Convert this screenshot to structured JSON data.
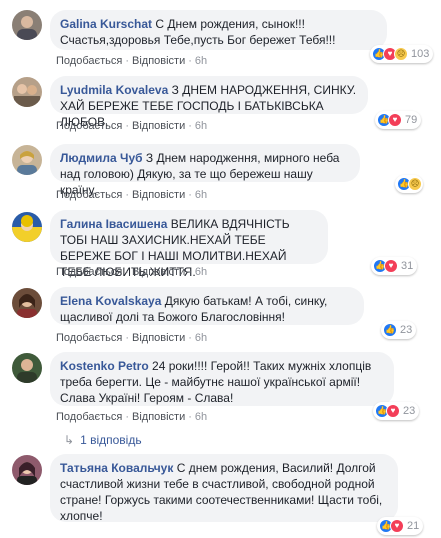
{
  "actions": {
    "like": "Подобається",
    "reply": "Відповісти"
  },
  "comments": [
    {
      "author": "Galina Kurschat",
      "text": "С Днем рождения, сынок!!! Счастья,здоровья Тебе,пусть Бог бережет Тебя!!!",
      "time": "6h",
      "reactions": [
        "like",
        "love",
        "sad"
      ],
      "count": "103"
    },
    {
      "author": "Lyudmila Kovaleva",
      "text": "З ДНЕМ НАРОДЖЕННЯ, СИНКУ. ХАЙ БЕРЕЖЕ ТЕБЕ ГОСПОДЬ І БАТЬКІВСЬКА ЛЮБОВ.",
      "time": "6h",
      "reactions": [
        "like",
        "love"
      ],
      "count": "79"
    },
    {
      "author": "Людмила Чуб",
      "text": "З Днем народження, мирного неба над головою) Дякую, за те що бережеш нашу країну.",
      "time": "6h",
      "reactions": [
        "like",
        "sad"
      ],
      "count": ""
    },
    {
      "author": "Галина Івасишена",
      "text": "ВЕЛИКА ВДЯЧНІСТЬ ТОБІ НАШ ЗАХИСНИК.НЕХАЙ ТЕБЕ БЕРЕЖЕ БОГ І НАШІ МОЛИТВИ.НЕХАЙ ТЕБЕ ЛЮБИТЬ ЖИТТЯ.",
      "time": "6h",
      "reactions": [
        "like",
        "love"
      ],
      "count": "31"
    },
    {
      "author": "Elena Kovalskaya",
      "text": "Дякую батькам! А тобі, синку, щасливої долі та Божого Благословіння!",
      "time": "6h",
      "reactions": [
        "like"
      ],
      "count": "23"
    },
    {
      "author": "Kostenko Petro",
      "text": "24 роки!!!! Герой!! Таких мужніх хлопців треба берегти. Це - майбутнє нашої української армії! Слава Україні! Героям - Слава!",
      "time": "6h",
      "reactions": [
        "like",
        "love"
      ],
      "count": "23"
    },
    {
      "author": "Татьяна Ковальчук",
      "text": "С днем рождения, Василий! Долгой счастливой жизни тебе в счастливой, свободной родной стране! Горжусь такими соотечественниками! Щасти тобі, хлопче!",
      "time": "6h",
      "reactions": [
        "like",
        "love"
      ],
      "count": "21"
    }
  ],
  "replies_link": "1 відповідь"
}
